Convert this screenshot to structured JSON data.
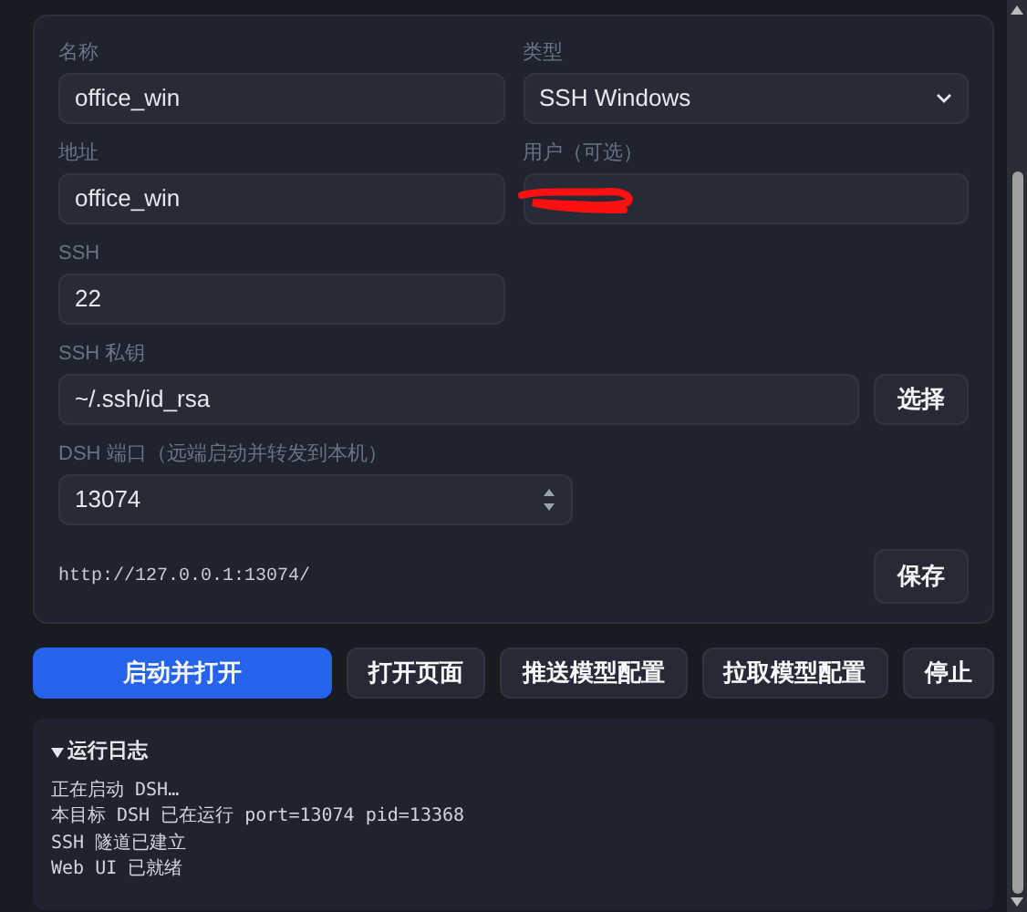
{
  "form": {
    "rows": [
      [
        {
          "kind": "text",
          "label": "名称",
          "value": "office_win"
        },
        {
          "kind": "select",
          "label": "类型",
          "value": "SSH Windows"
        }
      ],
      [
        {
          "kind": "text",
          "label": "地址",
          "value": "office_win"
        },
        {
          "kind": "text",
          "label": "用户（可选）",
          "redacted": true
        }
      ],
      [
        {
          "kind": "text",
          "label": "SSH",
          "value": "22"
        }
      ],
      [
        {
          "kind": "file",
          "label": "SSH 私钥",
          "value": "~/.ssh/id_rsa",
          "button": "选择"
        }
      ],
      [
        {
          "kind": "number",
          "label": "DSH 端口（远端启动并转发到本机）",
          "value": "13074"
        }
      ]
    ],
    "url": "http://127.0.0.1:13074/",
    "save": "保存"
  },
  "actions": [
    {
      "label": "启动并打开",
      "primary": true
    },
    {
      "label": "打开页面",
      "primary": false
    },
    {
      "label": "推送模型配置",
      "primary": false
    },
    {
      "label": "拉取模型配置",
      "primary": false
    },
    {
      "label": "停止",
      "primary": false
    }
  ],
  "log": {
    "title": "运行日志",
    "expanded": true,
    "lines": [
      "正在启动 DSH…",
      "本目标 DSH 已在运行 port=13074 pid=13368",
      "SSH 隧道已建立",
      "Web UI 已就绪"
    ]
  }
}
